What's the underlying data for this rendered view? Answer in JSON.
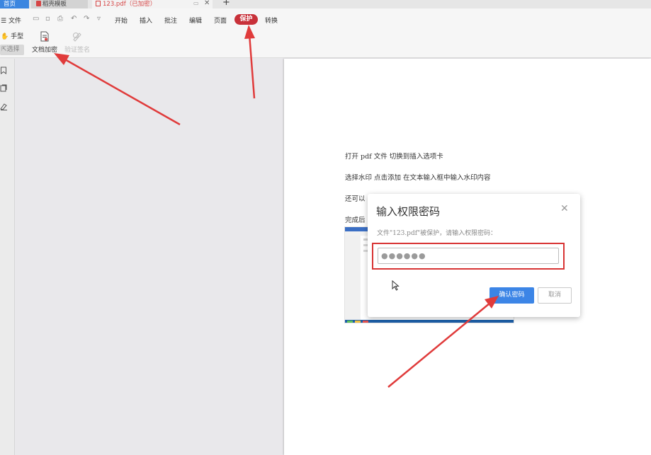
{
  "tabs": {
    "home": "首页",
    "template": "稻壳模板",
    "document": "123.pdf（已加密）"
  },
  "menu": {
    "file": "文件",
    "items": [
      "开始",
      "插入",
      "批注",
      "编辑",
      "页面",
      "保护",
      "转换"
    ]
  },
  "toolbar": {
    "hand": "手型",
    "select": "选择",
    "encrypt": "文档加密",
    "verify": "验证签名"
  },
  "page": {
    "lines": [
      "打开 pdf 文件   切换到插入选项卡",
      "选择水印    点击添加   在文本输入框中输入水印内容",
      "还可以",
      "完成后"
    ]
  },
  "dialog": {
    "title": "输入权限密码",
    "message": "文件\"123.pdf\"被保护，请输入权限密码：",
    "password": "●●●●●●",
    "confirm": "确认密码",
    "cancel": "取消"
  },
  "colors": {
    "accent": "#3c85e6",
    "protect": "#c8313a",
    "annotation": "#e03b3b"
  }
}
